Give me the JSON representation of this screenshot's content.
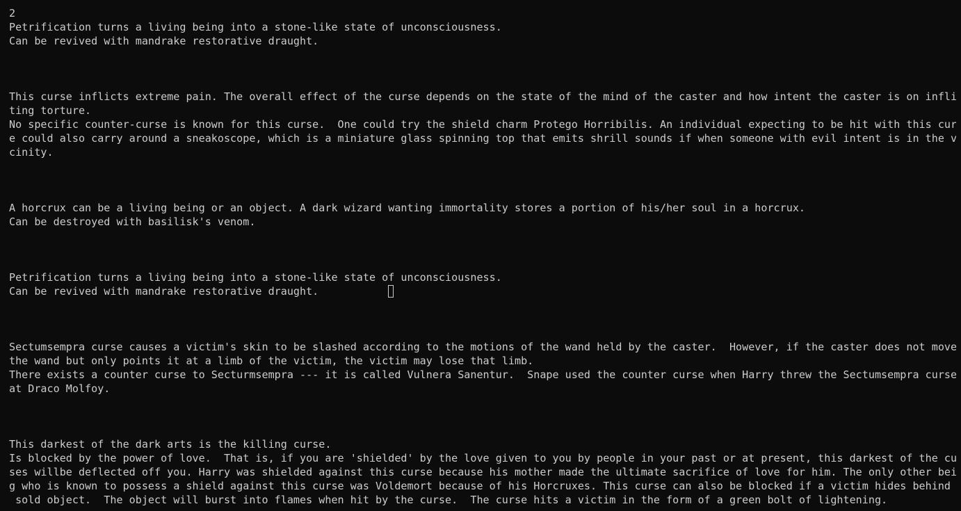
{
  "terminal": {
    "lines": [
      "2",
      "Petrification turns a living being into a stone-like state of unconsciousness.",
      "Can be revived with mandrake restorative draught.",
      "",
      "",
      "",
      "This curse inflicts extreme pain. The overall effect of the curse depends on the state of the mind of the caster and how intent the caster is on inflic",
      "ting torture.",
      "No specific counter-curse is known for this curse.  One could try the shield charm Protego Horribilis. An individual expecting to be hit with this curs",
      "e could also carry around a sneakoscope, which is a miniature glass spinning top that emits shrill sounds if when someone with evil intent is in the vi",
      "cinity.",
      "",
      "",
      "",
      "A horcrux can be a living being or an object. A dark wizard wanting immortality stores a portion of his/her soul in a horcrux.",
      "Can be destroyed with basilisk's venom.",
      "",
      "",
      "",
      "Petrification turns a living being into a stone-like state of unconsciousness.",
      "Can be revived with mandrake restorative draught.           ",
      "",
      "",
      "",
      "Sectumsempra curse causes a victim's skin to be slashed according to the motions of the wand held by the caster.  However, if the caster does not move",
      "the wand but only points it at a limb of the victim, the victim may lose that limb.",
      "There exists a counter curse to Secturmsempra --- it is called Vulnera Sanentur.  Snape used the counter curse when Harry threw the Sectumsempra curse",
      "at Draco Molfoy.",
      "",
      "",
      "",
      "This darkest of the dark arts is the killing curse.",
      "Is blocked by the power of love.  That is, if you are 'shielded' by the love given to you by people in your past or at present, this darkest of the cur",
      "ses willbe deflected off you. Harry was shielded against this curse because his mother made the ultimate sacrifice of love for him. The only other bein",
      "g who is known to possess a shield against this curse was Voldemort because of his Horcruxes. This curse can also be blocked if a victim hides behind a",
      " sold object.  The object will burst into flames when hit by the curse.  The curse hits a victim in the form of a green bolt of lightening."
    ]
  }
}
